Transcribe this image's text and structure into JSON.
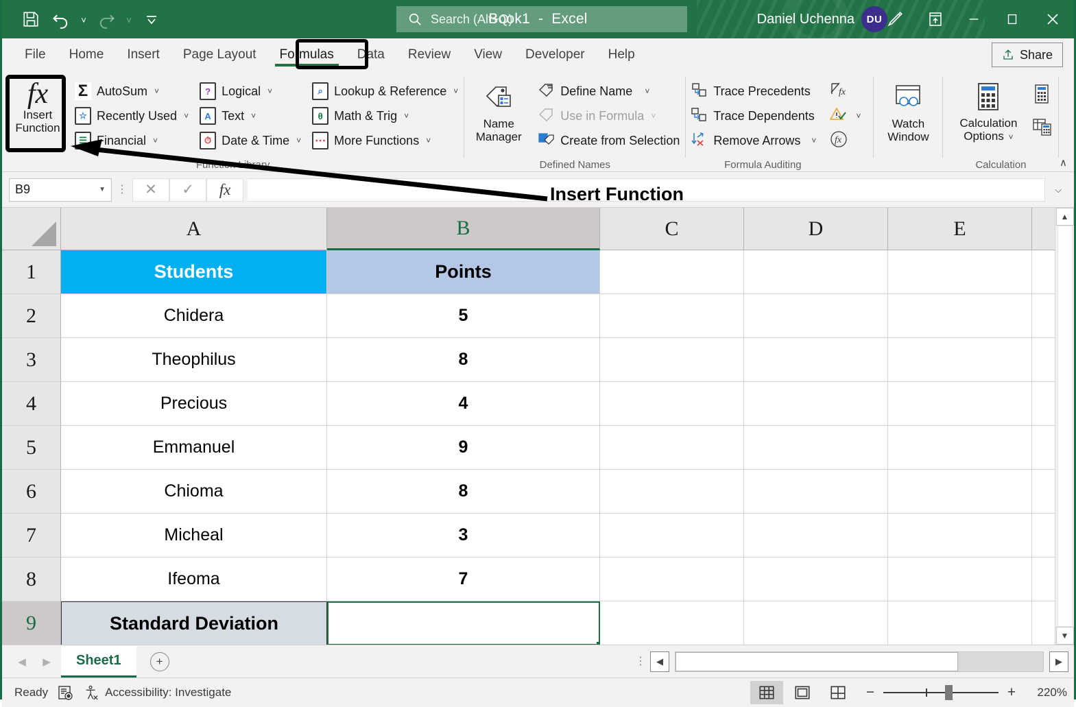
{
  "titlebar": {
    "document_title": "Book1",
    "title_separator": "-",
    "app_name": "Excel",
    "quick_access": [
      {
        "name": "save",
        "label": "Save"
      },
      {
        "name": "undo",
        "label": "Undo"
      },
      {
        "name": "redo",
        "label": "Redo"
      },
      {
        "name": "customize-quick-access-toolbar",
        "label": "Customize Quick Access Toolbar"
      }
    ],
    "search_placeholder": "Search (Alt+Q)",
    "user_name": "Daniel Uchenna",
    "user_initials": "DU",
    "window_buttons": {
      "minimize": "–",
      "maximize": "☐",
      "close": "✕"
    },
    "accent_color": "#217346"
  },
  "tabs": {
    "items": [
      {
        "label": "File"
      },
      {
        "label": "Home"
      },
      {
        "label": "Insert"
      },
      {
        "label": "Page Layout"
      },
      {
        "label": "Formulas"
      },
      {
        "label": "Data"
      },
      {
        "label": "Review"
      },
      {
        "label": "View"
      },
      {
        "label": "Developer"
      },
      {
        "label": "Help"
      }
    ],
    "active": "Formulas",
    "share_label": "Share"
  },
  "ribbon": {
    "groups": [
      {
        "name": "Function Library",
        "label": "Function Library",
        "big_button": {
          "line1": "Insert",
          "line2": "Function",
          "icon": "fx"
        },
        "col1": [
          {
            "label": "AutoSum",
            "icon": "Σ",
            "caret": true
          },
          {
            "label": "Recently Used",
            "icon": "☆",
            "caret": true
          },
          {
            "label": "Financial",
            "icon": "≡",
            "caret": true
          }
        ],
        "col2": [
          {
            "label": "Logical",
            "icon": "?",
            "caret": true
          },
          {
            "label": "Text",
            "icon": "A",
            "caret": true
          },
          {
            "label": "Date & Time",
            "icon": "◷",
            "caret": true
          }
        ],
        "col3": [
          {
            "label": "Lookup & Reference",
            "icon": "⌕",
            "caret": true
          },
          {
            "label": "Math & Trig",
            "icon": "θ",
            "caret": true
          },
          {
            "label": "More Functions",
            "icon": "⋯",
            "caret": true
          }
        ]
      },
      {
        "name": "Defined Names",
        "label": "Defined Names",
        "big_button": {
          "line1": "Name",
          "line2": "Manager",
          "icon": "name-manager"
        },
        "items": [
          {
            "label": "Define Name",
            "caret": true,
            "disabled": false
          },
          {
            "label": "Use in Formula",
            "caret": true,
            "disabled": true
          },
          {
            "label": "Create from Selection",
            "caret": false,
            "disabled": false
          }
        ]
      },
      {
        "name": "Formula Auditing",
        "label": "Formula Auditing",
        "items": [
          {
            "label": "Trace Precedents",
            "caret": false
          },
          {
            "label": "Trace Dependents",
            "caret": false
          },
          {
            "label": "Remove Arrows",
            "caret": true
          }
        ],
        "side_icons": [
          "show-formulas",
          "error-checking",
          "evaluate-formula"
        ],
        "big_button": {
          "line1": "Watch",
          "line2": "Window",
          "icon": "watch-window"
        }
      },
      {
        "name": "Calculation",
        "label": "Calculation",
        "big_button": {
          "line1": "Calculation",
          "line2": "Options",
          "icon": "calculation-options",
          "caret": true
        },
        "side_icons": [
          "calculate-now",
          "calculate-sheet"
        ]
      }
    ],
    "collapse_label": "∧"
  },
  "formula_bar": {
    "name_box_value": "B9",
    "cancel_label": "✕",
    "enter_label": "✓",
    "insert_function_label": "fx",
    "formula_value": "",
    "expand_label": "⌵"
  },
  "annotation": {
    "label": "Insert Function"
  },
  "grid": {
    "columns": [
      "A",
      "B",
      "C",
      "D",
      "E"
    ],
    "selected_column": "B",
    "selected_row": "9",
    "selected_cell": "B9",
    "rows": [
      {
        "num": "1",
        "a": "Students",
        "b": "Points",
        "style": "header"
      },
      {
        "num": "2",
        "a": "Chidera",
        "b": "5",
        "style": "data"
      },
      {
        "num": "3",
        "a": "Theophilus",
        "b": "8",
        "style": "data"
      },
      {
        "num": "4",
        "a": "Precious",
        "b": "4",
        "style": "data"
      },
      {
        "num": "5",
        "a": "Emmanuel",
        "b": "9",
        "style": "data"
      },
      {
        "num": "6",
        "a": "Chioma",
        "b": "8",
        "style": "data"
      },
      {
        "num": "7",
        "a": "Micheal",
        "b": "3",
        "style": "data"
      },
      {
        "num": "8",
        "a": "Ifeoma",
        "b": "7",
        "style": "data"
      },
      {
        "num": "9",
        "a": "Standard Deviation",
        "b": "",
        "style": "total"
      }
    ],
    "colors": {
      "students_header_fill": "#00B0F0",
      "points_header_fill": "#B4C7E7",
      "stdev_label_fill": "#D6DCE4",
      "selection_border": "#1E6B45"
    }
  },
  "sheet_bar": {
    "prev_label": "◀",
    "next_label": "▶",
    "sheets": [
      {
        "name": "Sheet1",
        "active": true
      }
    ],
    "add_sheet_label": "+"
  },
  "status_bar": {
    "mode": "Ready",
    "macro_label": "Record Macro",
    "accessibility": "Accessibility: Investigate",
    "views": [
      {
        "name": "normal-view",
        "active": true
      },
      {
        "name": "page-layout-view",
        "active": false
      },
      {
        "name": "page-break-preview",
        "active": false
      }
    ],
    "zoom_out": "−",
    "zoom_in": "+",
    "zoom_level": "220%"
  }
}
